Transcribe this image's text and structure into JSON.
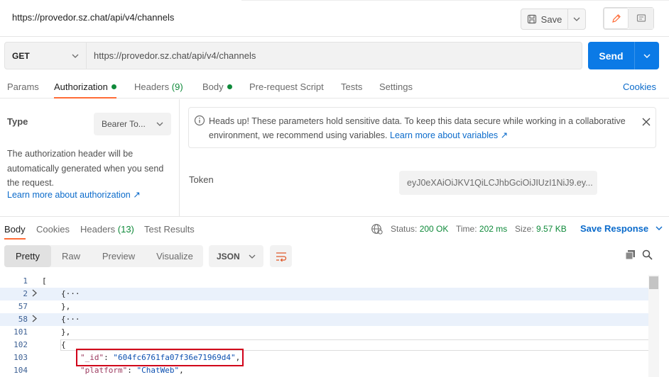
{
  "header": {
    "title": "https://provedor.sz.chat/api/v4/channels",
    "save_label": "Save"
  },
  "request": {
    "method": "GET",
    "url": "https://provedor.sz.chat/api/v4/channels",
    "send_label": "Send"
  },
  "request_tabs": {
    "params": "Params",
    "authorization": "Authorization",
    "headers": "Headers",
    "headers_count": "(9)",
    "body": "Body",
    "prerequest": "Pre-request Script",
    "tests": "Tests",
    "settings": "Settings",
    "cookies": "Cookies"
  },
  "auth": {
    "type_label": "Type",
    "type_value": "Bearer To...",
    "description": "The authorization header will be automatically generated when you send the request.",
    "learn_link": "Learn more about authorization ↗",
    "alert_text": "Heads up! These parameters hold sensitive data. To keep this data secure while working in a collaborative environment, we recommend using variables.",
    "alert_link": "Learn more about variables ↗",
    "token_label": "Token",
    "token_value": "eyJ0eXAiOiJKV1QiLCJhbGciOiJIUzI1NiJ9.ey..."
  },
  "response_tabs": {
    "body": "Body",
    "cookies": "Cookies",
    "headers": "Headers",
    "headers_count": "(13)",
    "test_results": "Test Results",
    "status_label": "Status:",
    "status_value": "200 OK",
    "time_label": "Time:",
    "time_value": "202 ms",
    "size_label": "Size:",
    "size_value": "9.57 KB",
    "save_response": "Save Response"
  },
  "format": {
    "pretty": "Pretty",
    "raw": "Raw",
    "preview": "Preview",
    "visualize": "Visualize",
    "json": "JSON"
  },
  "code_lines": [
    {
      "num": "1",
      "text": "["
    },
    {
      "num": "2",
      "text": "{···"
    },
    {
      "num": "57",
      "text": "},"
    },
    {
      "num": "58",
      "text": "{···"
    },
    {
      "num": "101",
      "text": "},"
    },
    {
      "num": "102",
      "text": "{"
    },
    {
      "num": "103",
      "key": "\"_id\"",
      "value": "\"604fc6761fa07f36e71969d4\""
    },
    {
      "num": "104",
      "key": "\"platform\"",
      "value": "\"ChatWeb\""
    }
  ],
  "colors": {
    "accent": "#ff6c37",
    "send": "#0b7ae6",
    "link": "#0b6bcb",
    "ok": "#0f8a3a",
    "highlight_box": "#d1001a"
  }
}
